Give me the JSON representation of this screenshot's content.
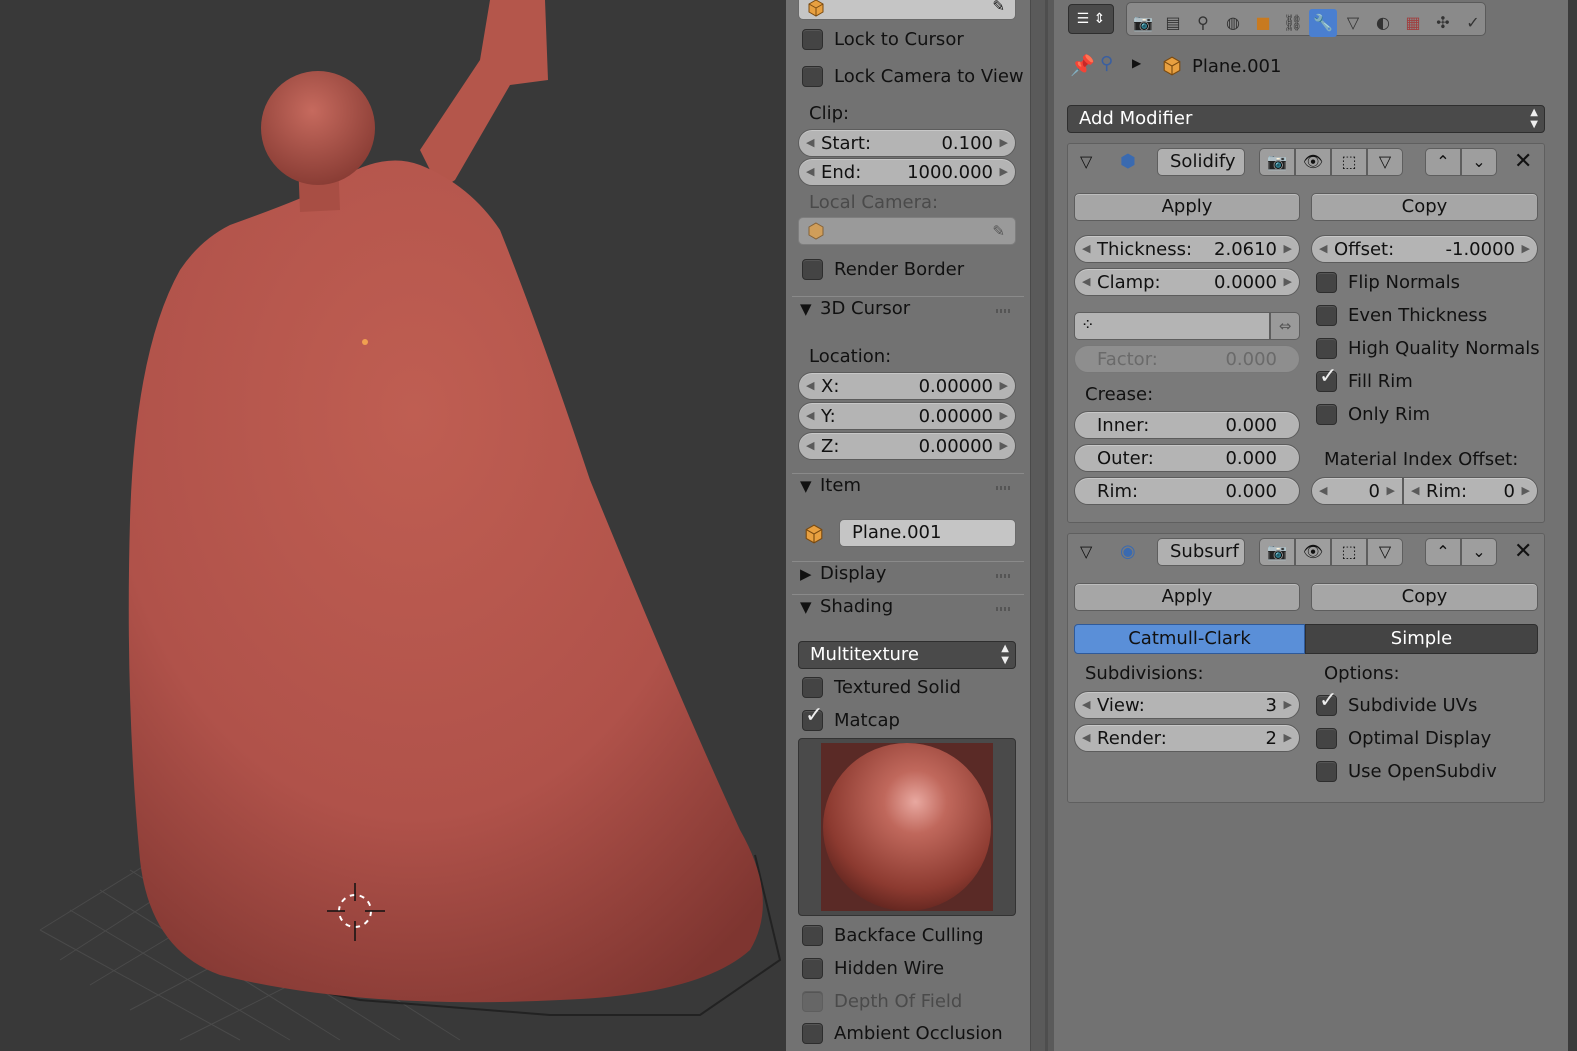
{
  "viewport": {
    "bg": "#393939",
    "mesh_color": "#b5564a"
  },
  "npanel": {
    "lock_to_cursor": "Lock to Cursor",
    "lock_camera_to_view": "Lock Camera to View",
    "clip_label": "Clip:",
    "clip_start_label": "Start:",
    "clip_start_value": "0.100",
    "clip_end_label": "End:",
    "clip_end_value": "1000.000",
    "local_camera_label": "Local Camera:",
    "render_border": "Render Border",
    "cursor_section": "3D Cursor",
    "location_label": "Location:",
    "x_label": "X:",
    "x_value": "0.00000",
    "y_label": "Y:",
    "y_value": "0.00000",
    "z_label": "Z:",
    "z_value": "0.00000",
    "item_section": "Item",
    "item_name": "Plane.001",
    "display_section": "Display",
    "shading_section": "Shading",
    "shading_mode": "Multitexture",
    "textured_solid": "Textured Solid",
    "matcap": "Matcap",
    "matcap_checked": true,
    "backface_culling": "Backface Culling",
    "hidden_wire": "Hidden Wire",
    "depth_of_field": "Depth Of Field",
    "ambient_occlusion": "Ambient Occlusion"
  },
  "props": {
    "object_name": "Plane.001",
    "add_modifier": "Add Modifier",
    "solidify": {
      "name": "Solidify",
      "apply": "Apply",
      "copy": "Copy",
      "thickness_label": "Thickness:",
      "thickness_value": "2.0610",
      "offset_label": "Offset:",
      "offset_value": "-1.0000",
      "clamp_label": "Clamp:",
      "clamp_value": "0.0000",
      "flip_normals": "Flip Normals",
      "even_thickness": "Even Thickness",
      "high_quality_normals": "High Quality Normals",
      "fill_rim": "Fill Rim",
      "only_rim": "Only Rim",
      "factor_label": "Factor:",
      "factor_value": "0.000",
      "crease_label": "Crease:",
      "inner_label": "Inner:",
      "inner_value": "0.000",
      "outer_label": "Outer:",
      "outer_value": "0.000",
      "rim_label": "Rim:",
      "rim_value": "0.000",
      "material_index_offset": "Material Index Offset:",
      "mat_offset_value": "0",
      "mat_rim_label": "Rim:",
      "mat_rim_value": "0"
    },
    "subsurf": {
      "name": "Subsurf",
      "apply": "Apply",
      "copy": "Copy",
      "catmull_clark": "Catmull-Clark",
      "simple": "Simple",
      "subdivisions_label": "Subdivisions:",
      "options_label": "Options:",
      "view_label": "View:",
      "view_value": "3",
      "render_label": "Render:",
      "render_value": "2",
      "subdivide_uvs": "Subdivide UVs",
      "optimal_display": "Optimal Display",
      "use_opensubdiv": "Use OpenSubdiv"
    }
  },
  "colors": {
    "accent": "#5a8fd8",
    "panel": "#727272"
  }
}
